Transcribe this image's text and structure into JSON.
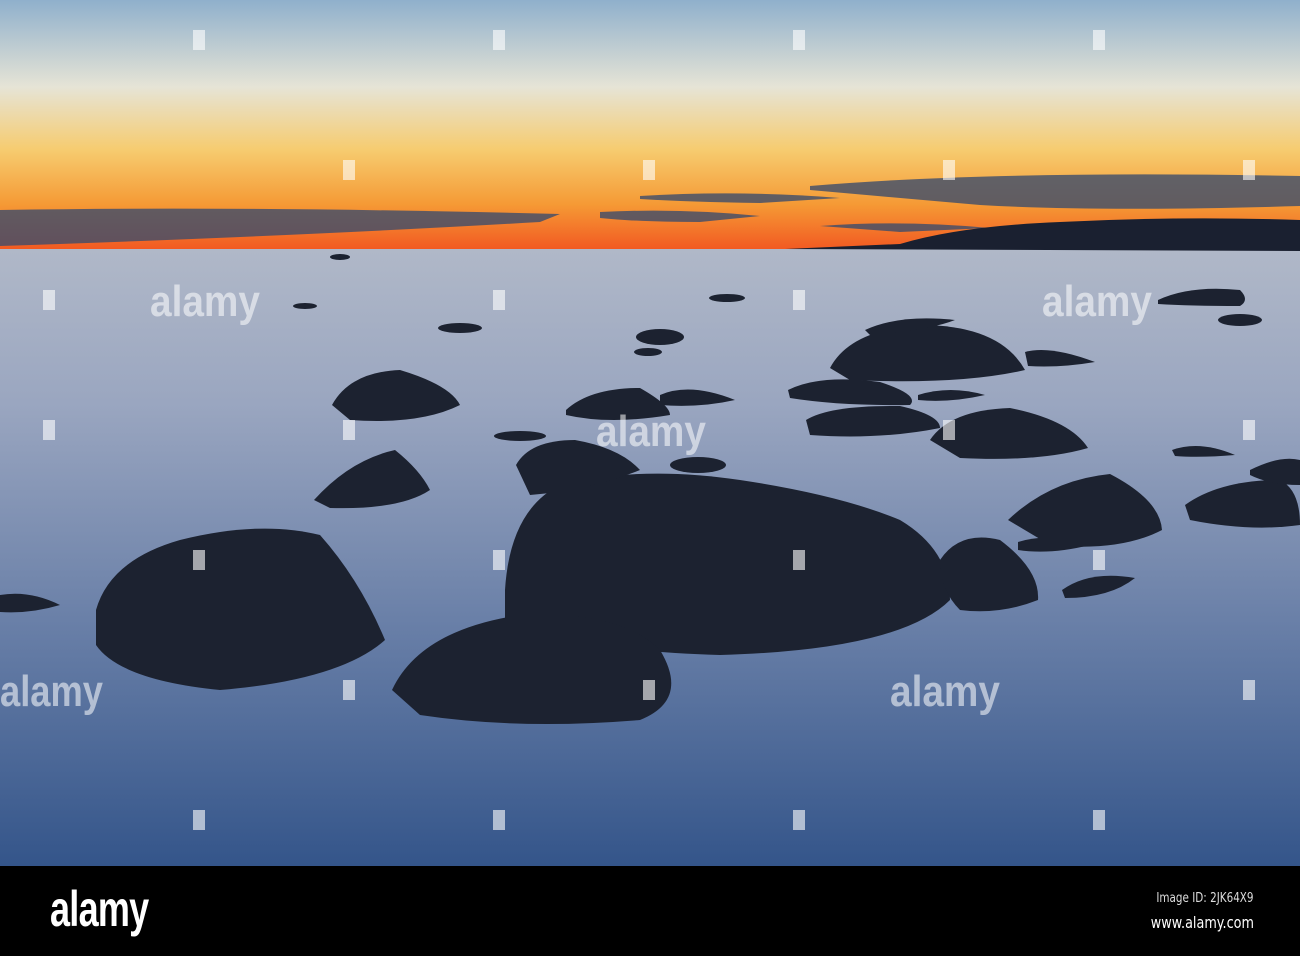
{
  "photo": {
    "subject": "sunset-over-rocky-sea",
    "colors": {
      "sky_top": "#8fb0cc",
      "sky_glow": "#f5a030",
      "horizon": "#f04a20",
      "sea": "#5a7098",
      "rock": "#1c2230"
    }
  },
  "watermark": {
    "text": "alamy"
  },
  "footer": {
    "logo": "alamy",
    "image_id": "Image ID: 2JK64X9",
    "website": "www.alamy.com"
  }
}
